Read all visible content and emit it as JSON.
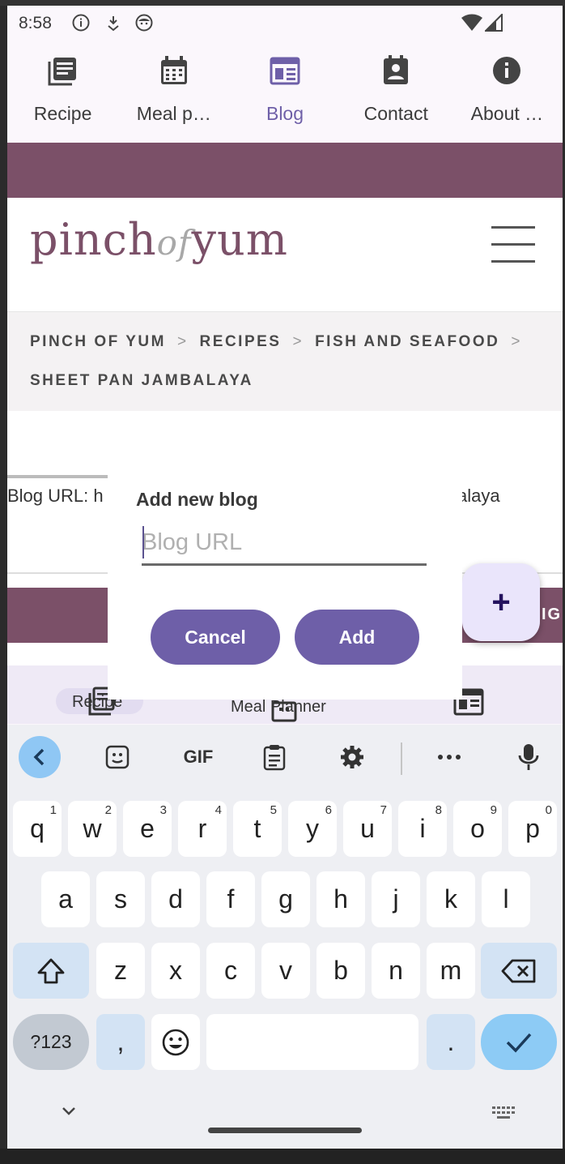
{
  "status_bar": {
    "time": "8:58"
  },
  "tabs": [
    {
      "label": "Recipe",
      "icon": "recipe-list-icon",
      "active": false
    },
    {
      "label": "Meal p…",
      "icon": "calendar-icon",
      "active": false
    },
    {
      "label": "Blog",
      "icon": "blog-icon",
      "active": true
    },
    {
      "label": "Contact",
      "icon": "contact-icon",
      "active": false
    },
    {
      "label": "About …",
      "icon": "info-icon",
      "active": false
    }
  ],
  "web": {
    "logo": {
      "pre": "pinch",
      "mid": "of",
      "post": "yum"
    },
    "breadcrumbs": {
      "items": [
        "PINCH OF YUM",
        "RECIPES",
        "FISH AND SEAFOOD"
      ],
      "last": "SHEET PAN JAMBALAYA",
      "separator": ">"
    },
    "url_prefix": "Blog URL: h",
    "url_suffix": "alaya",
    "banner_partial": "IG"
  },
  "bottom_nav": {
    "recipe_label": "Recipe",
    "meal_label": "Meal Planner"
  },
  "dialog": {
    "title": "Add new blog",
    "placeholder": "Blog URL",
    "value": "",
    "cancel_label": "Cancel",
    "add_label": "Add"
  },
  "fab": {
    "label": "+"
  },
  "keyboard": {
    "toolbar": [
      "back-icon",
      "sticker-icon",
      "GIF",
      "clipboard-icon",
      "settings-icon",
      "more-icon",
      "mic-icon"
    ],
    "gif_label": "GIF",
    "row1": [
      {
        "k": "q",
        "n": "1"
      },
      {
        "k": "w",
        "n": "2"
      },
      {
        "k": "e",
        "n": "3"
      },
      {
        "k": "r",
        "n": "4"
      },
      {
        "k": "t",
        "n": "5"
      },
      {
        "k": "y",
        "n": "6"
      },
      {
        "k": "u",
        "n": "7"
      },
      {
        "k": "i",
        "n": "8"
      },
      {
        "k": "o",
        "n": "9"
      },
      {
        "k": "p",
        "n": "0"
      }
    ],
    "row2": [
      "a",
      "s",
      "d",
      "f",
      "g",
      "h",
      "j",
      "k",
      "l"
    ],
    "row3": [
      "z",
      "x",
      "c",
      "v",
      "b",
      "n",
      "m"
    ],
    "num_label": "?123",
    "comma": ",",
    "period": "."
  },
  "colors": {
    "accent": "#6e5fa8",
    "brand": "#7b5068",
    "keyboard_action": "#8dcbf5"
  }
}
